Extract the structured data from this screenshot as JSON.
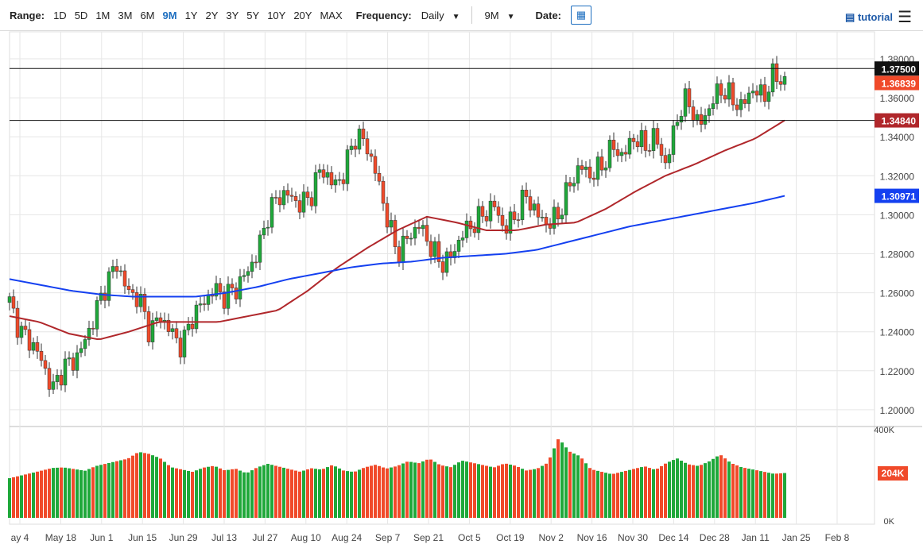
{
  "toolbar": {
    "range_label": "Range:",
    "ranges": [
      "1D",
      "5D",
      "1M",
      "3M",
      "6M",
      "9M",
      "1Y",
      "2Y",
      "3Y",
      "5Y",
      "10Y",
      "20Y",
      "MAX"
    ],
    "active_range": "9M",
    "frequency_label": "Frequency:",
    "frequency": "Daily",
    "period": "9M",
    "date_label": "Date:",
    "tutorial": "tutorial",
    "icons": {
      "calendar": "calendar-icon",
      "menu": "hamburger-menu-icon",
      "tutorial": "film-icon",
      "dropdown": "chevron-down-icon"
    }
  },
  "chart_data": {
    "type": "candlestick",
    "ylim": [
      1.19,
      1.385
    ],
    "y_ticks": [
      "1.20000",
      "1.22000",
      "1.24000",
      "1.26000",
      "1.28000",
      "1.30000",
      "1.32000",
      "1.34000",
      "1.36000",
      "1.38000"
    ],
    "x_ticks": [
      "ay 4",
      "May 18",
      "Jun 1",
      "Jun 15",
      "Jun 29",
      "Jul 13",
      "Jul 27",
      "Aug 10",
      "Aug 24",
      "Sep 7",
      "Sep 21",
      "Oct 5",
      "Oct 19",
      "Nov 2",
      "Nov 16",
      "Nov 30",
      "Dec 14",
      "Dec 28",
      "Jan 11",
      "Jan 25",
      "Feb 8"
    ],
    "close": [
      1.255,
      1.24,
      1.235,
      1.225,
      1.21,
      1.222,
      1.225,
      1.235,
      1.25,
      1.265,
      1.275,
      1.26,
      1.258,
      1.24,
      1.248,
      1.24,
      1.232,
      1.248,
      1.255,
      1.262,
      1.258,
      1.262,
      1.27,
      1.28,
      1.3,
      1.31,
      1.31,
      1.305,
      1.31,
      1.325,
      1.315,
      1.32,
      1.34,
      1.338,
      1.322,
      1.3,
      1.28,
      1.288,
      1.295,
      1.285,
      1.275,
      1.278,
      1.29,
      1.295,
      1.3,
      1.305,
      1.292,
      1.3,
      1.31,
      1.3,
      1.295,
      1.3,
      1.315,
      1.325,
      1.32,
      1.325,
      1.335,
      1.33,
      1.34,
      1.335,
      1.34,
      1.325,
      1.35,
      1.36,
      1.345,
      1.355,
      1.365,
      1.36,
      1.355,
      1.365,
      1.36,
      1.372,
      1.368
    ],
    "ma_red": [
      1.248,
      1.245,
      1.239,
      1.236,
      1.24,
      1.245,
      1.245,
      1.245,
      1.248,
      1.251,
      1.261,
      1.273,
      1.283,
      1.292,
      1.299,
      1.296,
      1.292,
      1.292,
      1.295,
      1.296,
      1.303,
      1.312,
      1.32,
      1.326,
      1.333,
      1.339,
      1.3484
    ],
    "ma_blue": [
      1.267,
      1.264,
      1.261,
      1.259,
      1.258,
      1.258,
      1.258,
      1.26,
      1.263,
      1.267,
      1.27,
      1.273,
      1.275,
      1.276,
      1.278,
      1.279,
      1.28,
      1.282,
      1.286,
      1.29,
      1.294,
      1.297,
      1.3,
      1.303,
      1.306,
      1.3097
    ],
    "levels": [
      {
        "value": 1.375,
        "label": "1.37500",
        "color": "#111111"
      },
      {
        "value": 1.3484,
        "label": "1.34840",
        "color": "#b0272b"
      }
    ],
    "last_price": {
      "label": "1.36839",
      "value": 1.36839,
      "color": "#f04a2a"
    },
    "ma_red_label": {
      "label": "1.34840",
      "color": "#b0272b"
    },
    "ma_blue_label": {
      "label": "1.30971",
      "color": "#1440f0"
    },
    "volume": {
      "ylim": [
        0,
        400000
      ],
      "ticks": [
        "400K",
        "0K"
      ],
      "last_label": "204K",
      "values_k": [
        200,
        210,
        220,
        230,
        240,
        240,
        230,
        220,
        240,
        250,
        260,
        270,
        300,
        290,
        270,
        230,
        220,
        210,
        230,
        240,
        220,
        230,
        210,
        240,
        260,
        250,
        240,
        230,
        250,
        240,
        260,
        230,
        220,
        240,
        250,
        230,
        240,
        260,
        250,
        270,
        240,
        230,
        260,
        250,
        240,
        230,
        250,
        240,
        220,
        230,
        260,
        380,
        320,
        300,
        240,
        230,
        220,
        230,
        240,
        250,
        230,
        260,
        280,
        250,
        240,
        260,
        290,
        250,
        230,
        220,
        210,
        200,
        204
      ]
    },
    "colors": {
      "up": "#1fa83a",
      "down": "#f04a2a",
      "ma_red": "#b0272b",
      "ma_blue": "#1440f0"
    }
  }
}
